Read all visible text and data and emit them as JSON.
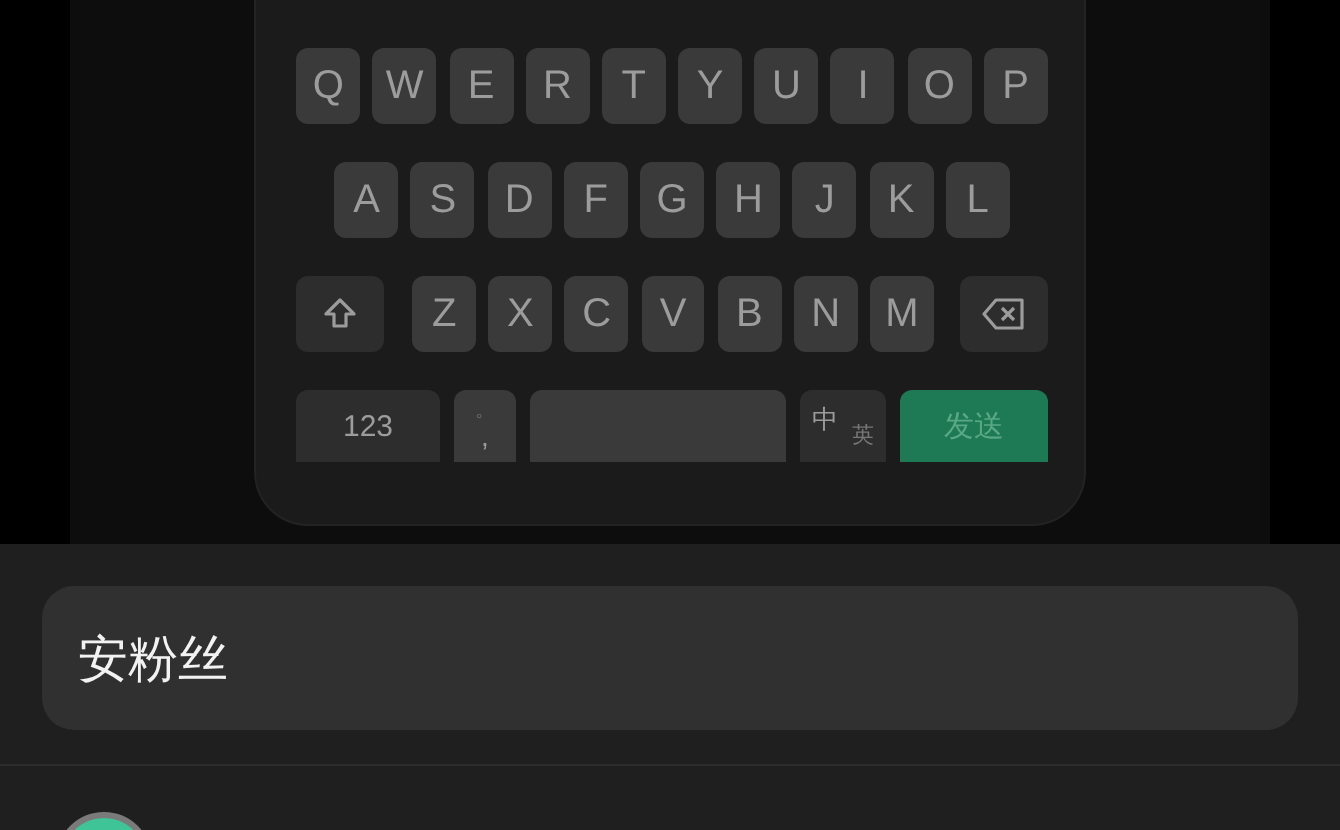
{
  "keyboard": {
    "rows": [
      {
        "keys": [
          {
            "kind": "letter",
            "label": "Q"
          },
          {
            "kind": "letter",
            "label": "W"
          },
          {
            "kind": "letter",
            "label": "E"
          },
          {
            "kind": "letter",
            "label": "R"
          },
          {
            "kind": "letter",
            "label": "T"
          },
          {
            "kind": "letter",
            "label": "Y"
          },
          {
            "kind": "letter",
            "label": "U"
          },
          {
            "kind": "letter",
            "label": "I"
          },
          {
            "kind": "letter",
            "label": "O"
          },
          {
            "kind": "letter",
            "label": "P"
          }
        ]
      },
      {
        "keys": [
          {
            "kind": "letter",
            "label": "A"
          },
          {
            "kind": "letter",
            "label": "S"
          },
          {
            "kind": "letter",
            "label": "D"
          },
          {
            "kind": "letter",
            "label": "F"
          },
          {
            "kind": "letter",
            "label": "G"
          },
          {
            "kind": "letter",
            "label": "H"
          },
          {
            "kind": "letter",
            "label": "J"
          },
          {
            "kind": "letter",
            "label": "K"
          },
          {
            "kind": "letter",
            "label": "L"
          }
        ]
      },
      {
        "keys": [
          {
            "kind": "shift"
          },
          {
            "kind": "letter",
            "label": "Z"
          },
          {
            "kind": "letter",
            "label": "X"
          },
          {
            "kind": "letter",
            "label": "C"
          },
          {
            "kind": "letter",
            "label": "V"
          },
          {
            "kind": "letter",
            "label": "B"
          },
          {
            "kind": "letter",
            "label": "N"
          },
          {
            "kind": "letter",
            "label": "M"
          },
          {
            "kind": "backspace"
          }
        ]
      },
      {
        "keys": [
          {
            "kind": "numbers",
            "label": "123"
          },
          {
            "kind": "punct",
            "label": ",",
            "hint": "。"
          },
          {
            "kind": "space"
          },
          {
            "kind": "lang",
            "label": "中",
            "alt": "英"
          },
          {
            "kind": "send",
            "label": "发送"
          }
        ]
      }
    ]
  },
  "input": {
    "value": "安粉丝"
  }
}
